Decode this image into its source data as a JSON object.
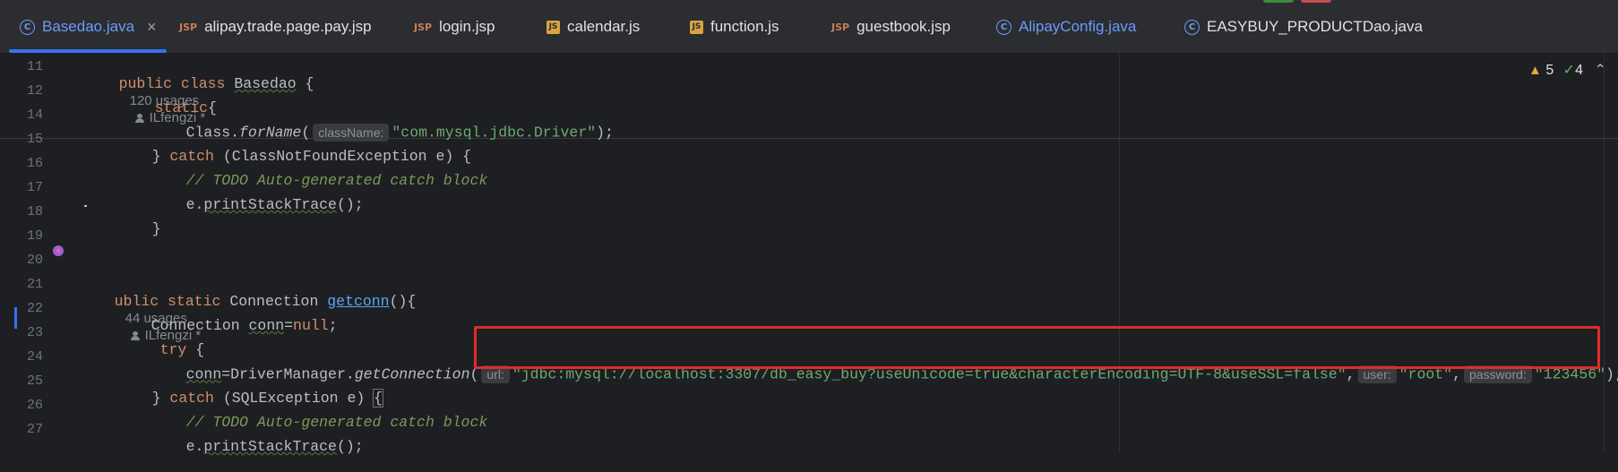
{
  "tabs": [
    {
      "icon": "class-icon",
      "label": "Basedao.java",
      "active": true,
      "close": "×"
    },
    {
      "icon": "jsp-icon",
      "label": "alipay.trade.page.pay.jsp"
    },
    {
      "icon": "jsp-icon",
      "label": "login.jsp"
    },
    {
      "icon": "js-icon",
      "label": "calendar.js"
    },
    {
      "icon": "js-icon",
      "label": "function.js"
    },
    {
      "icon": "jsp-icon",
      "label": "guestbook.jsp"
    },
    {
      "icon": "class-icon",
      "label": "AlipayConfig.java"
    },
    {
      "icon": "class-icon",
      "label": "EASYBUY_PRODUCTDao.java"
    }
  ],
  "icons": {
    "jsp": "JSP",
    "js": "JS",
    "class": "C"
  },
  "inspections": {
    "warnings": "5",
    "weak": "4",
    "warn_glyph": "▲",
    "check_glyph": "✓",
    "chevron": "⌃"
  },
  "lines": {
    "l11": {
      "num": "11",
      "kw": "public class ",
      "name": "Basedao",
      "rest": " {",
      "usages": "120 usages",
      "author": "ILfengzi *"
    },
    "l12": {
      "num": "12",
      "kw": "static",
      "rest": "{"
    },
    "l14": {
      "num": "14",
      "pre": "Class.",
      "method": "forName",
      "open": "(",
      "hint": "className:",
      "str": "\"com.mysql.jdbc.Driver\"",
      "close": ");"
    },
    "l15": {
      "num": "15",
      "pre": "} ",
      "kw": "catch",
      "rest": " (ClassNotFoundException e) {"
    },
    "l16": {
      "num": "16",
      "comment": "// TODO Auto-generated catch block"
    },
    "l17": {
      "num": "17",
      "obj": "e.",
      "method": "printStackTrace",
      "rest": "();"
    },
    "l18": {
      "num": "18",
      "text": "}"
    },
    "l19": {
      "num": "19"
    },
    "l20": {
      "num": "20"
    },
    "l21": {
      "num": "21",
      "kw": "ublic static ",
      "type": "Connection ",
      "name": "getconn",
      "rest": "(){",
      "usages": "44 usages",
      "author": "ILfengzi *"
    },
    "l22": {
      "num": "22",
      "type": "Connection ",
      "var": "conn",
      "rest": "=",
      "kw": "null",
      "end": ";"
    },
    "l23": {
      "num": "23",
      "kw": "try",
      "rest": " {"
    },
    "l24": {
      "num": "24",
      "var": "conn",
      "pre": "=DriverManager.",
      "method": "getConnection",
      "open": "(",
      "hint_url": "url:",
      "url": "\"jdbc:mysql://localhost:3307/db_easy_buy?useUnicode=true&characterEncoding=UTF-8&useSSL=false\"",
      "comma1": ",",
      "hint_user": "user:",
      "user": "\"root\"",
      "comma2": ",",
      "hint_pw": "password:",
      "pw": "\"123456\"",
      "close": ");"
    },
    "l25": {
      "num": "25",
      "pre": "} ",
      "kw": "catch",
      "rest": " (SQLException e) ",
      "brace": "{"
    },
    "l26": {
      "num": "26",
      "comment": "// TODO Auto-generated catch block"
    },
    "l27": {
      "num": "27",
      "obj": "e.",
      "method": "printStackTrace",
      "rest": "();"
    }
  },
  "colors": {
    "accent": "#3574f0",
    "highlight": "#e02b2b",
    "string": "#6aab73",
    "keyword": "#cf8e6d",
    "comment": "#7a9a5a",
    "function": "#56a8f5"
  }
}
